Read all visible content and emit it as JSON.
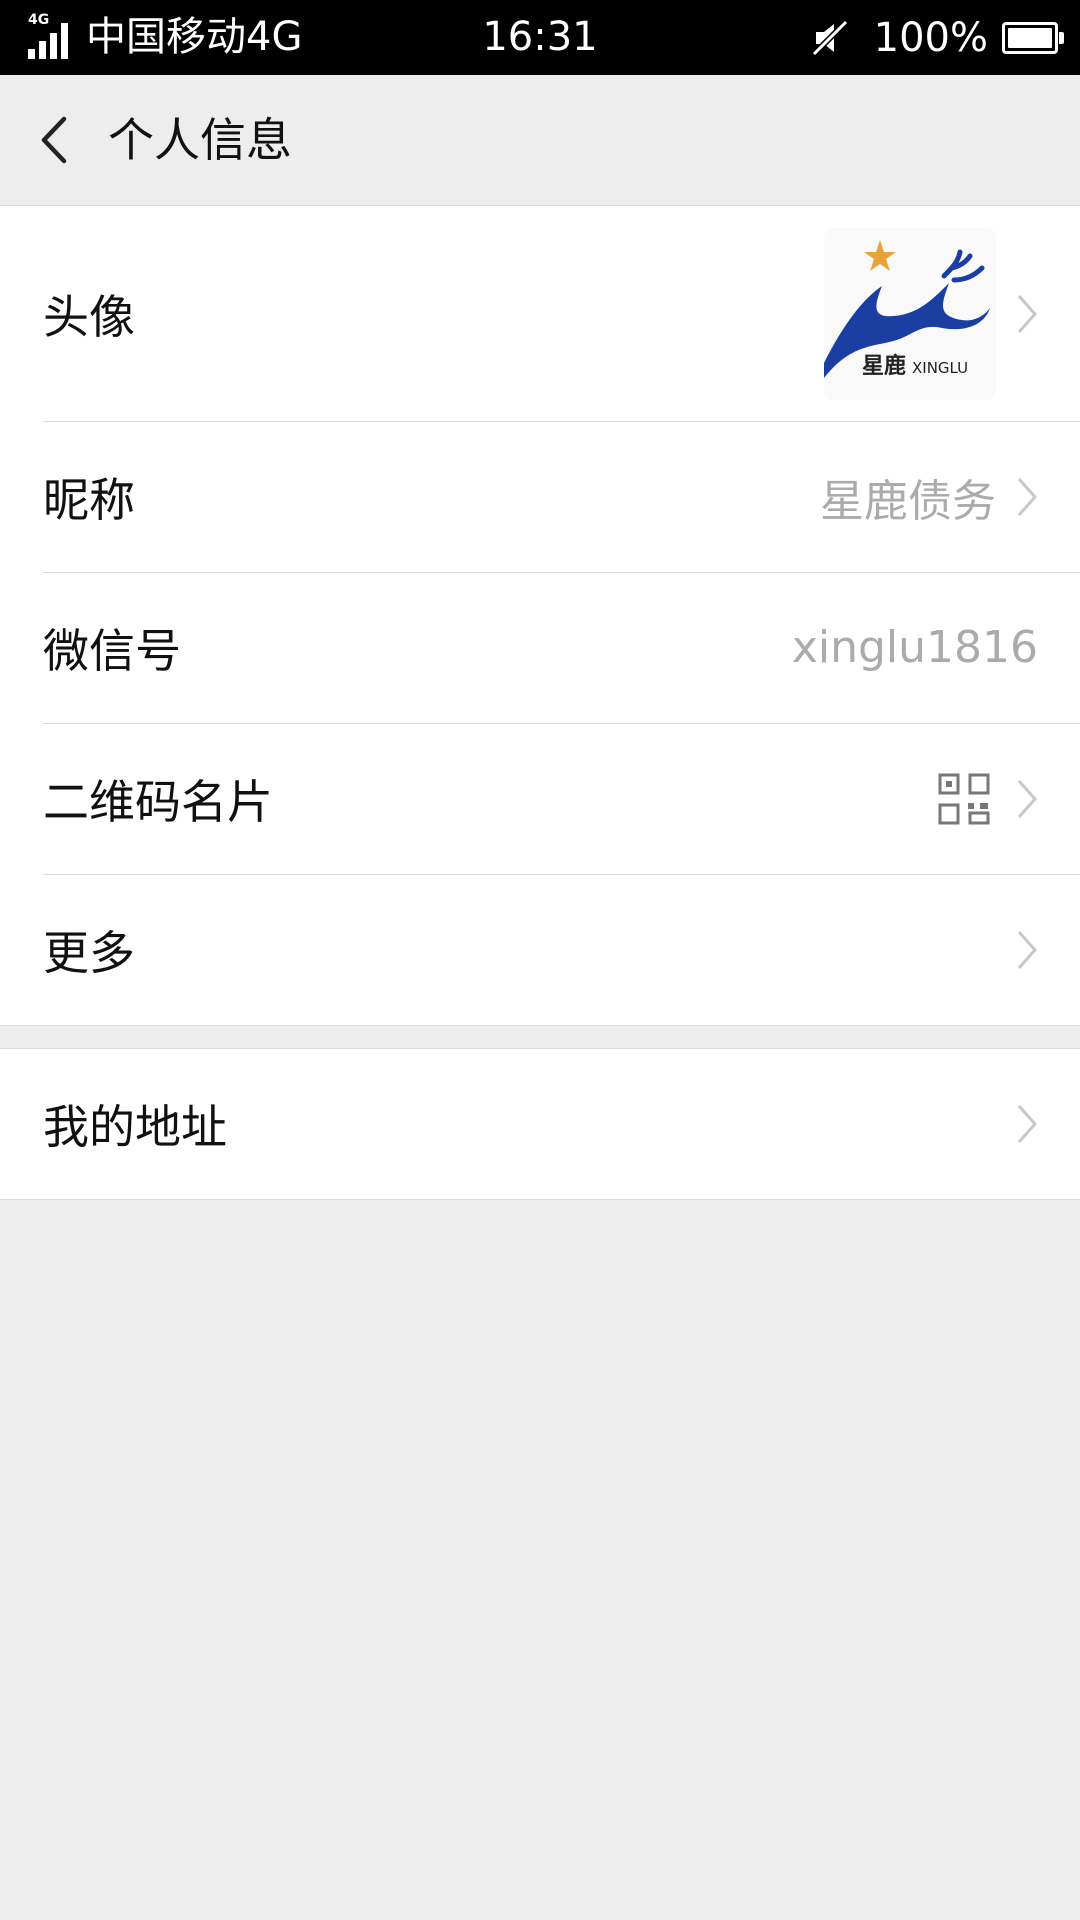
{
  "status_bar": {
    "network": "4G",
    "carrier": "中国移动4G",
    "time": "16:31",
    "battery": "100%"
  },
  "header": {
    "title": "个人信息"
  },
  "rows": {
    "avatar": {
      "label": "头像",
      "logo_text": "星鹿",
      "logo_text_en": "XINGLU"
    },
    "nickname": {
      "label": "昵称",
      "value": "星鹿债务"
    },
    "wechat_id": {
      "label": "微信号",
      "value": "xinglu1816"
    },
    "qr_code": {
      "label": "二维码名片"
    },
    "more": {
      "label": "更多"
    },
    "address": {
      "label": "我的地址"
    }
  },
  "colors": {
    "logo_blue": "#1b3ea3",
    "logo_star": "#e8a23a"
  }
}
